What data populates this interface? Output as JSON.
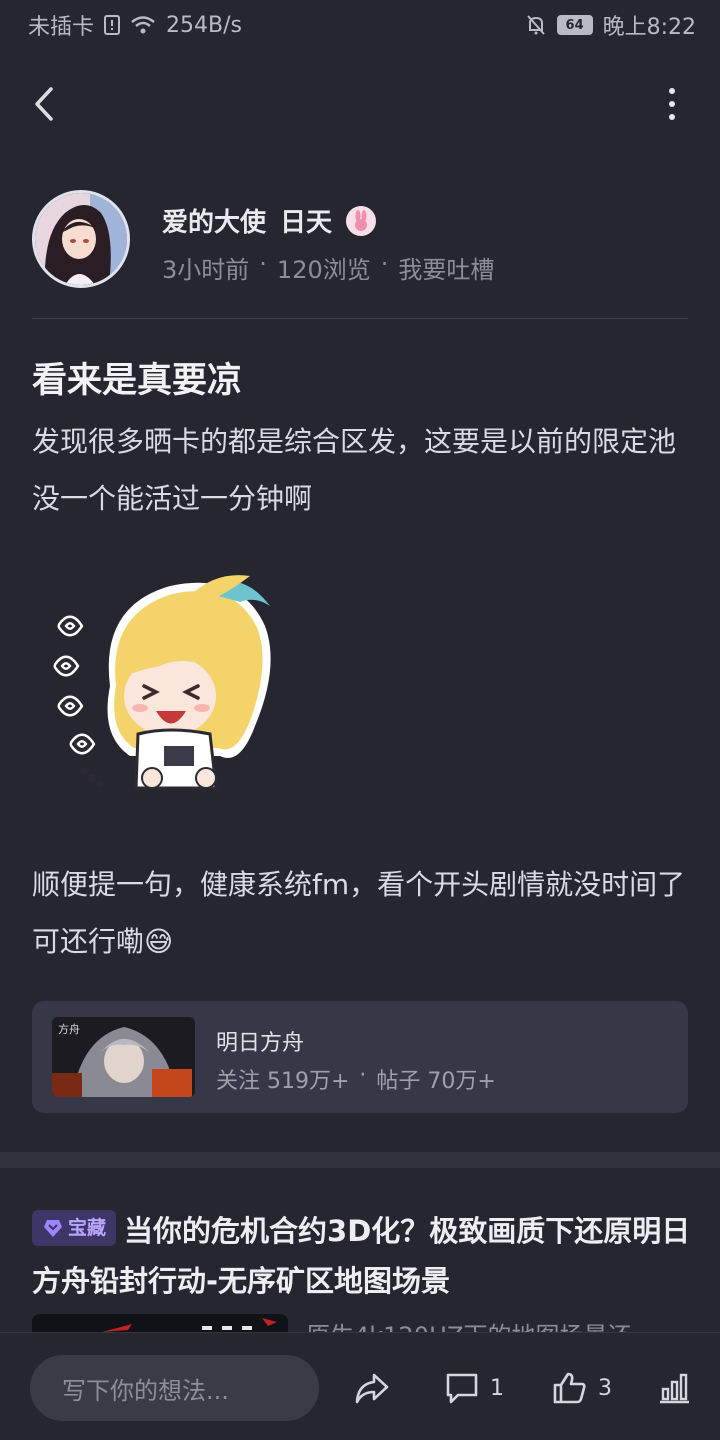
{
  "status_bar": {
    "carrier": "未插卡",
    "speed": "254B/s",
    "battery": "64",
    "time": "晚上8:22"
  },
  "author": {
    "name": "爱的大使",
    "suffix": "日天",
    "time_ago": "3小时前",
    "views": "120浏览",
    "category": "我要吐槽",
    "dot": "·"
  },
  "post": {
    "title": "看来是真要凉",
    "paragraph1": "发现很多晒卡的都是综合区发，这要是以前的限定池没一个能活过一分钟啊",
    "paragraph2": "顺便提一句，健康系统fm，看个开头剧情就没时间了可还行嘞😅"
  },
  "game_card": {
    "name": "明日方舟",
    "followers": "关注 519万+",
    "posts": "帖子 70万+",
    "dot": "·"
  },
  "recommendation": {
    "tag": "宝藏",
    "title": "当你的危机合约3D化？极致画质下还原明日方舟铅封行动-无序矿区地图场景",
    "snippet": "原生4k120HZ下的地图场景还"
  },
  "bottom_bar": {
    "comment_placeholder": "写下你的想法...",
    "comment_count": "1",
    "like_count": "3"
  },
  "colors": {
    "background": "#25262f",
    "card": "#363847",
    "tag_bg": "#3d3666",
    "tag_text": "#b9a6ff"
  },
  "icons": [
    "back-icon",
    "more-icon",
    "wifi-icon",
    "mute-icon",
    "share-icon",
    "comment-icon",
    "like-icon",
    "stats-icon"
  ]
}
